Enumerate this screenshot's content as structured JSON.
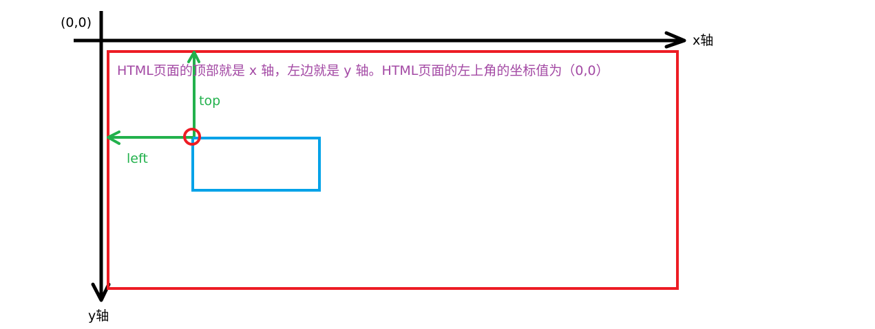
{
  "labels": {
    "origin": "(0,0)",
    "x_axis": "x轴",
    "y_axis": "y轴",
    "top": "top",
    "left": "left",
    "note": "HTML页面的顶部就是 x 轴，左边就是 y 轴。HTML页面的左上角的坐标值为（0,0）"
  },
  "colors": {
    "axis": "#000000",
    "page_border": "#ed1c24",
    "element_box": "#00a2e8",
    "offset_arrows": "#22b14c",
    "corner_marker": "#ed1c24",
    "note_text": "#a349a4"
  }
}
